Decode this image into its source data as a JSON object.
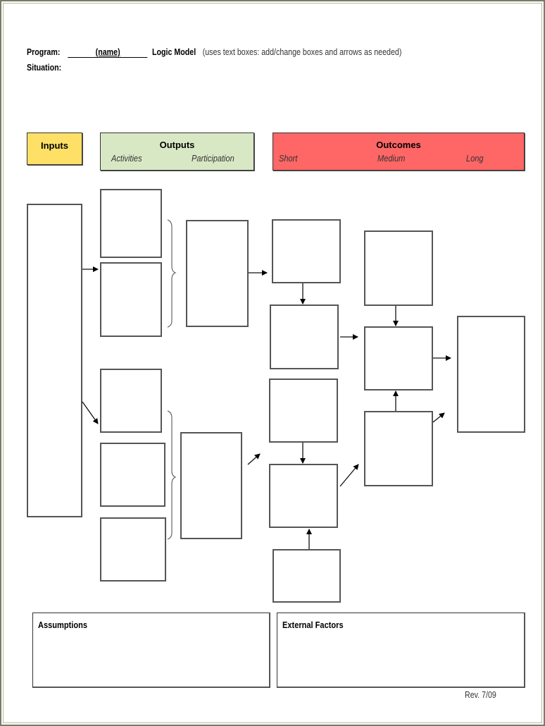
{
  "header": {
    "program_label": "Program:",
    "name_placeholder": "(name)",
    "logic_model_label": "Logic Model",
    "instructions": "(uses text boxes: add/change boxes and arrows as needed)",
    "situation_label": "Situation:"
  },
  "bands": {
    "inputs": {
      "title": "Inputs",
      "color": "#FFE066"
    },
    "outputs": {
      "title": "Outputs",
      "subs": [
        "Activities",
        "Participation"
      ],
      "color": "#D9E8C4"
    },
    "outcomes": {
      "title": "Outcomes",
      "subs": [
        "Short",
        "Medium",
        "Long"
      ],
      "color": "#FF6666"
    }
  },
  "bottom": {
    "assumptions_label": "Assumptions",
    "external_factors_label": "External Factors"
  },
  "footer": {
    "revision": "Rev. 7/09"
  }
}
